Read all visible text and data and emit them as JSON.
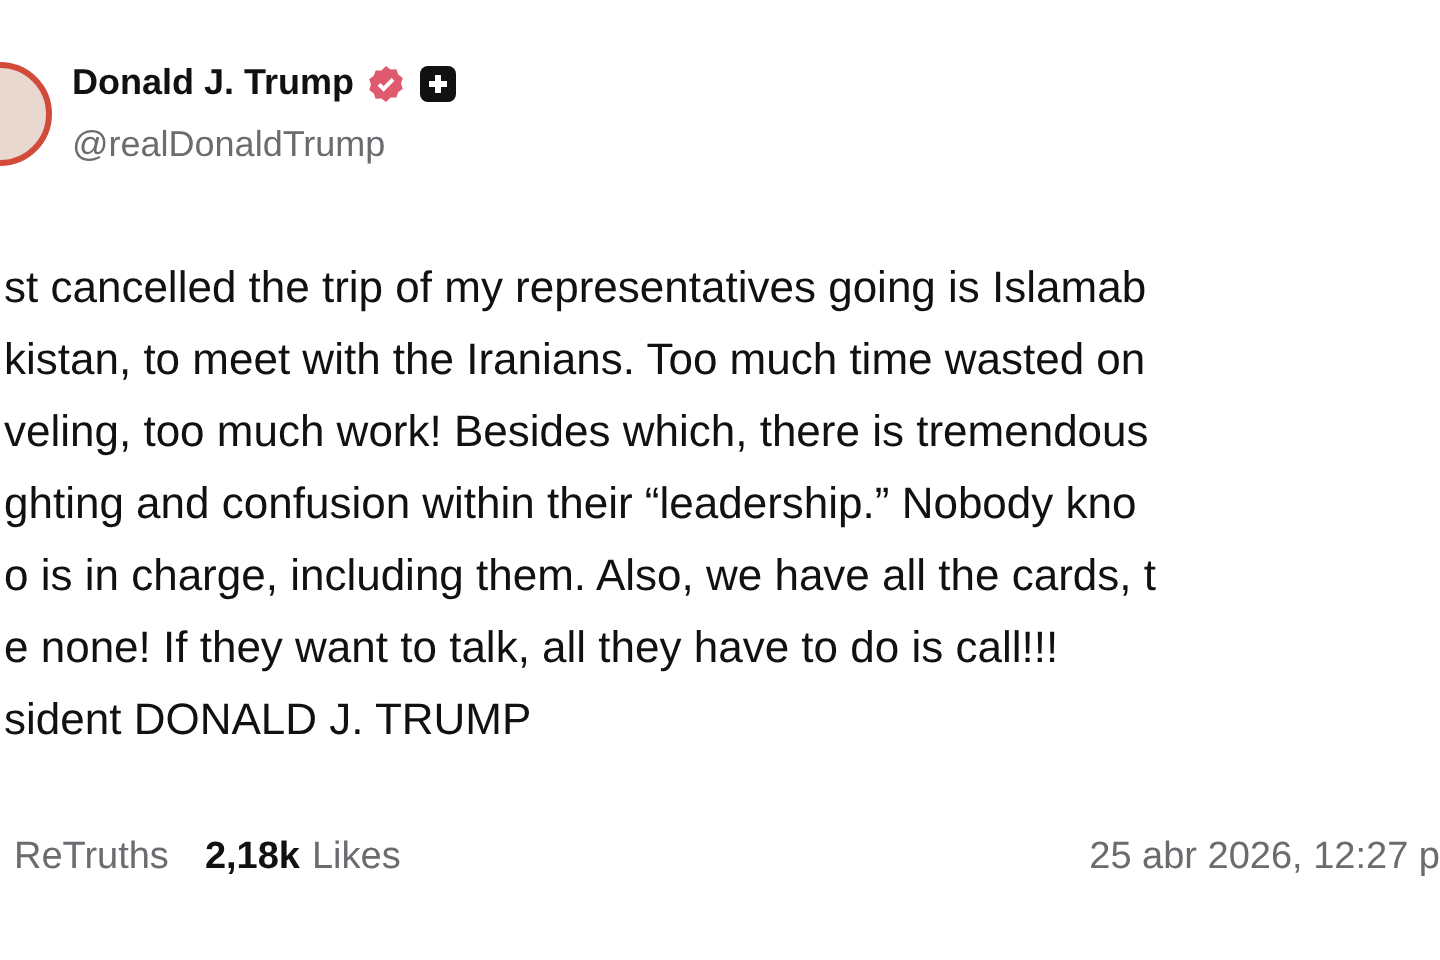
{
  "author": {
    "name": "Donald J. Trump",
    "handle": "@realDonaldTrump",
    "verified": true
  },
  "body_lines": [
    "st cancelled the trip of my representatives going is Islamab",
    "kistan, to meet with the Iranians. Too much time wasted on",
    "veling, too much work! Besides which, there is tremendous",
    "ghting and confusion within their “leadership.” Nobody kno",
    "o is in charge, including them. Also, we have all the cards, t",
    "e none! If they want to talk, all they have to do is call!!!",
    "sident DONALD J. TRUMP"
  ],
  "footer": {
    "retruths_label": "ReTruths",
    "likes_count": "2,18k",
    "likes_label": "Likes",
    "timestamp": "25 abr 2026, 12:27 p"
  }
}
